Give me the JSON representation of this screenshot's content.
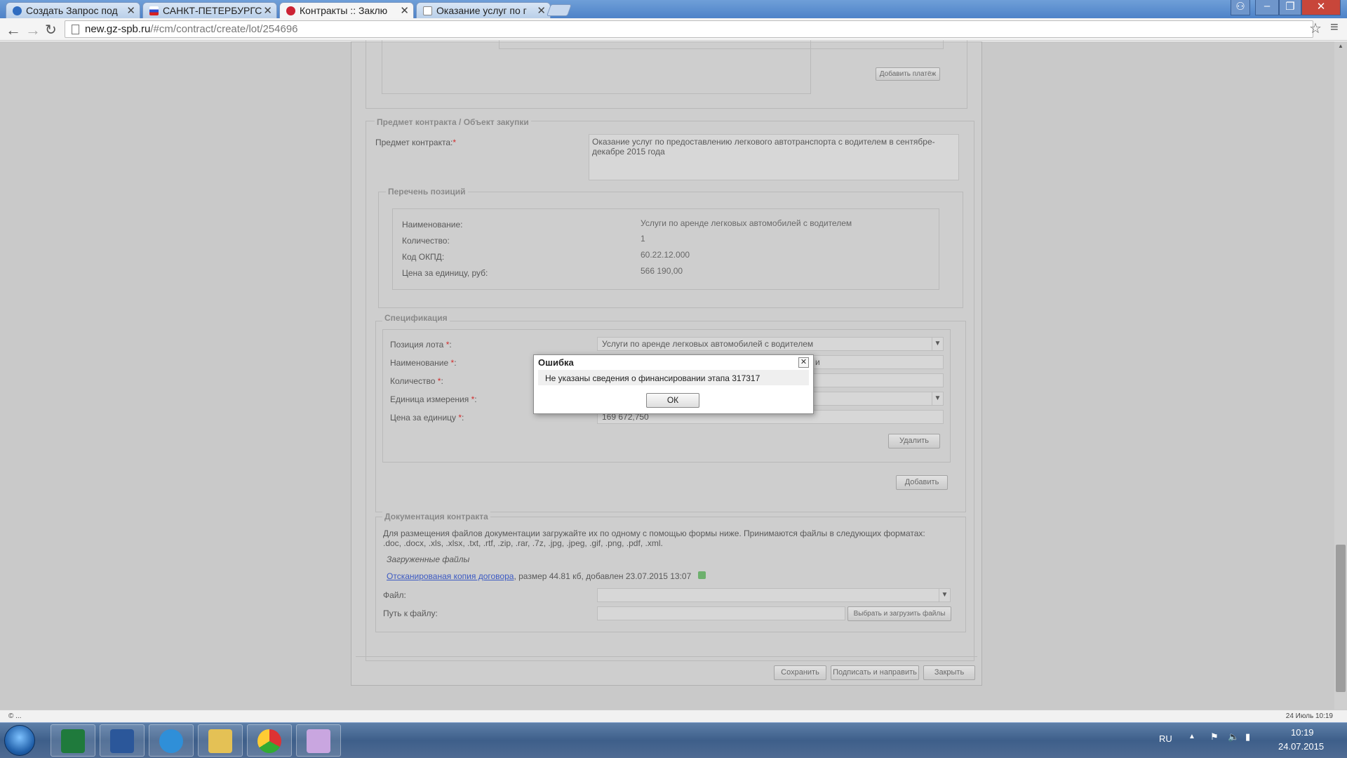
{
  "browser": {
    "tabs": [
      {
        "title": "Создать Запрос под",
        "icon": "globe-favicon"
      },
      {
        "title": "САНКТ-ПЕТЕРБУРГС",
        "icon": "flag-favicon"
      },
      {
        "title": "Контракты :: Заклю",
        "icon": "gz-favicon",
        "active": true
      },
      {
        "title": "Оказание услуг по г",
        "icon": "page-favicon"
      }
    ],
    "url_host": "new.gz-spb.ru",
    "url_path": "/#cm/contract/create/lot/254696"
  },
  "payments": {
    "add_button": "Добавить платёж"
  },
  "subject": {
    "legend": "Предмет контракта / Объект закупки",
    "label": "Предмет контракта:",
    "required_mark": "*",
    "value": "Оказание услуг по предоставлению легкового автотранспорта с водителем в сентябре-декабре 2015 года"
  },
  "positions": {
    "legend": "Перечень позиций",
    "rows": [
      {
        "label": "Наименование:",
        "value": "Услуги по аренде легковых автомобилей с водителем"
      },
      {
        "label": "Количество:",
        "value": "1"
      },
      {
        "label": "Код ОКПД:",
        "value": "60.22.12.000"
      },
      {
        "label": "Цена за единицу, руб:",
        "value": "566 190,00"
      }
    ]
  },
  "spec": {
    "legend": "Спецификация",
    "fields": [
      {
        "label": "Позиция лота ",
        "value": "Услуги по аренде легковых автомобилей с водителем"
      },
      {
        "label": "Наименование ",
        "value": "и"
      },
      {
        "label": "Количество ",
        "value": ""
      },
      {
        "label": "Единица измерения ",
        "value": ""
      },
      {
        "label": "Цена за единицу ",
        "value": "169 672,750"
      }
    ],
    "required_mark": "*",
    "colon": ":",
    "delete_button": "Удалить",
    "add_button": "Добавить"
  },
  "docs": {
    "legend": "Документация контракта",
    "instructions_line1": "Для размещения файлов документации загружайте их по одному с помощью формы ниже. Принимаются файлы в следующих форматах:",
    "instructions_line2": ".doc, .docx, .xls, .xlsx, .txt, .rtf, .zip, .rar, .7z, .jpg, .jpeg, .gif, .png, .pdf, .xml.",
    "uploaded_label": "Загруженные файлы",
    "file_link": "Отсканированая копия договора",
    "file_meta": ", размер 44.81 кб, добавлен 23.07.2015 13:07",
    "file_field_label": "Файл:",
    "path_field_label": "Путь к файлу:",
    "upload_button": "Выбрать и загрузить файлы"
  },
  "footer_buttons": {
    "save": "Сохранить",
    "sign_send": "Подписать и направить",
    "close": "Закрыть"
  },
  "dialog": {
    "title": "Ошибка",
    "message": "Не указаны сведения о финансировании этапа 317317",
    "ok": "ОК"
  },
  "status": {
    "left": "© ...",
    "right": "24 Июль 10:19"
  },
  "taskbar": {
    "apps": [
      "excel-icon",
      "word-icon",
      "internet-explorer-icon",
      "file-explorer-icon",
      "chrome-icon",
      "paint-icon"
    ],
    "language": "RU",
    "time": "10:19",
    "date": "24.07.2015"
  }
}
